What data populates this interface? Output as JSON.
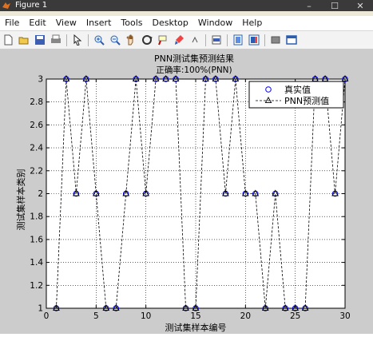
{
  "window": {
    "title": "Figure 1",
    "controls": [
      "–",
      "☐",
      "✕"
    ]
  },
  "menu": {
    "items": [
      "File",
      "Edit",
      "View",
      "Insert",
      "Tools",
      "Desktop",
      "Window",
      "Help"
    ]
  },
  "toolbar": {
    "icons": [
      "new-file-icon",
      "open-folder-icon",
      "save-icon",
      "print-icon",
      "pointer-icon",
      "zoom-in-icon",
      "zoom-out-icon",
      "pan-hand-icon",
      "rotate-3d-icon",
      "data-cursor-icon",
      "brush-icon",
      "link-plot-icon",
      "colorbar-icon",
      "legend-icon",
      "hide-plot-tools-icon",
      "show-plot-tools-icon"
    ]
  },
  "chart_data": {
    "type": "line",
    "title": "PNN测试集预测结果",
    "subtitle": "正确率:100%(PNN)",
    "xlabel": "测试集样本编号",
    "ylabel": "测试集样本类别",
    "xlim": [
      0,
      30
    ],
    "ylim": [
      1,
      3
    ],
    "xticks": [
      0,
      5,
      10,
      15,
      20,
      25,
      30
    ],
    "yticks": [
      1,
      1.2,
      1.4,
      1.6,
      1.8,
      2,
      2.2,
      2.4,
      2.6,
      2.8,
      3
    ],
    "xtick_labels": [
      "0",
      "5",
      "10",
      "15",
      "20",
      "25",
      "30"
    ],
    "ytick_labels": [
      "1",
      "1.2",
      "1.4",
      "1.6",
      "1.8",
      "2",
      "2.2",
      "2.4",
      "2.6",
      "2.8",
      "3"
    ],
    "grid": true,
    "legend_position": "top-right",
    "x": [
      1,
      2,
      3,
      4,
      5,
      6,
      7,
      8,
      9,
      10,
      11,
      12,
      13,
      14,
      15,
      16,
      17,
      18,
      19,
      20,
      21,
      22,
      23,
      24,
      25,
      26,
      27,
      28,
      29,
      30
    ],
    "series": [
      {
        "name": "真实值",
        "marker": "circle",
        "line": "none",
        "color": "#0000ff",
        "values": [
          1,
          3,
          2,
          3,
          2,
          1,
          1,
          2,
          3,
          2,
          3,
          3,
          3,
          1,
          1,
          3,
          3,
          2,
          3,
          2,
          2,
          1,
          2,
          1,
          1,
          1,
          3,
          3,
          2,
          3
        ]
      },
      {
        "name": "PNN预测值",
        "marker": "triangle",
        "line": "dashed",
        "color": "#000000",
        "values": [
          1,
          3,
          2,
          3,
          2,
          1,
          1,
          2,
          3,
          2,
          3,
          3,
          3,
          1,
          1,
          3,
          3,
          2,
          3,
          2,
          2,
          1,
          2,
          1,
          1,
          1,
          3,
          3,
          2,
          3
        ]
      }
    ]
  }
}
